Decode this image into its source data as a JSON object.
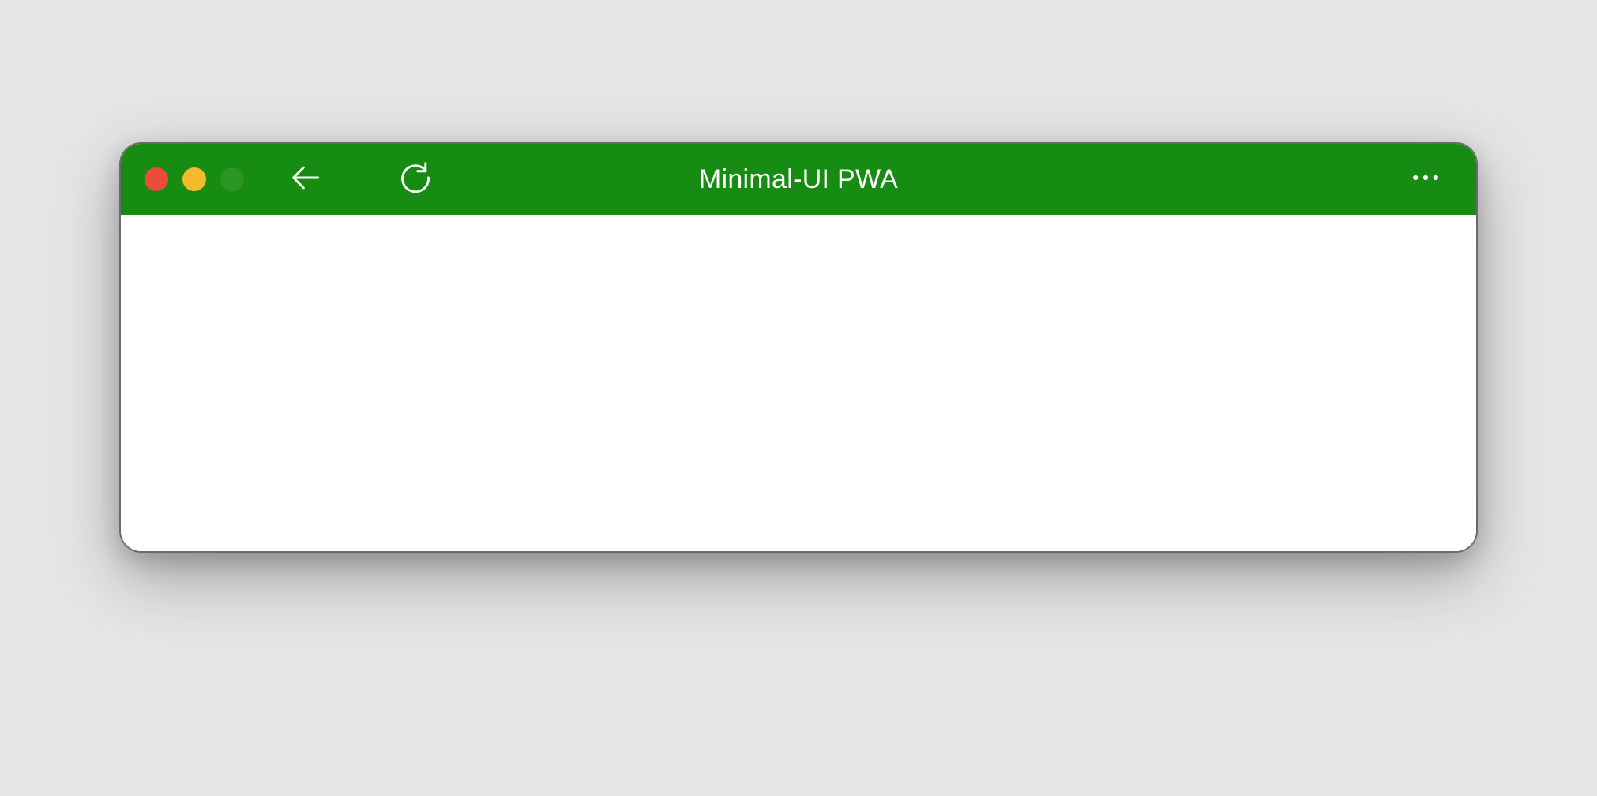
{
  "window": {
    "title": "Minimal-UI PWA"
  },
  "colors": {
    "titlebar_bg": "#178c13",
    "close": "#ec4c3e",
    "minimize": "#f3bb2c",
    "maximize": "#2a8e20"
  },
  "icons": {
    "back": "arrow-left-icon",
    "reload": "refresh-icon",
    "more": "ellipsis-icon"
  }
}
